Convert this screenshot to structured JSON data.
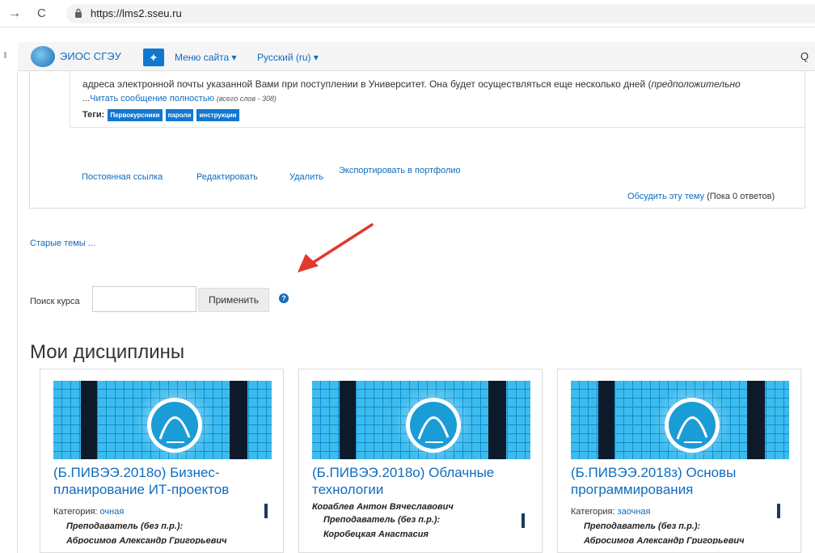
{
  "browser": {
    "back_glyph": "→",
    "reload_glyph": "C",
    "url": "https://lms2.sseu.ru"
  },
  "navbar": {
    "site_name": "ЭИОС СГЭУ",
    "sitemap_glyph": "⯌",
    "menu_site": "Меню сайта ▾",
    "language": "Русский (ru) ▾",
    "search_glyph": "Q"
  },
  "post": {
    "line1_text": "адреса электронной почты указанной Вами при поступлении в Университет. Она будет осуществляться еще несколько дней (",
    "line1_italic": "предположительно",
    "line2_prefix": "...",
    "read_more": "Читать сообщение полностью",
    "word_count": "(всего слов - 308)",
    "tags_label": "Теги:",
    "tags": [
      "Первокурсники",
      "пароли",
      "инструкции"
    ],
    "actions": {
      "permalink": "Постоянная ссылка",
      "edit": "Редактировать",
      "delete": "Удалить",
      "export": "Экспортировать в портфолио"
    },
    "discuss_link": "Обсудить эту тему",
    "replies": " (Пока 0 ответов)"
  },
  "older_topics": "Старые темы ...",
  "course_search": {
    "label": "Поиск курса",
    "value": "",
    "button": "Применить",
    "help_glyph": "?"
  },
  "heading": "Мои дисциплины",
  "courses": [
    {
      "title": "(Б.ПИВЭЭ.2018о) Бизнес-планирование ИТ-проектов",
      "category_label": "Категория: ",
      "category": "очная",
      "teacher_role": "Преподаватель (без п.р.):",
      "teacher_name": "Абросимов Александр Григорьевич"
    },
    {
      "title": "(Б.ПИВЭЭ.2018о) Облачные технологии",
      "teacher_partial": "Кораблев Антон Вячеславович",
      "teacher_role": "Преподаватель (без п.р.):",
      "teacher_name": "Коробецкая Анастасия"
    },
    {
      "title": "(Б.ПИВЭЭ.2018з) Основы программирования",
      "category_label": "Категория: ",
      "category": "заочная",
      "teacher_role": "Преподаватель (без п.р.):",
      "teacher_name": "Абросимов Александр Григорьевич"
    }
  ],
  "colors": {
    "link": "#0f6cbf",
    "tag": "#1177d1",
    "arrow": "#e03a2f",
    "card_image": "#0a9bd8"
  }
}
